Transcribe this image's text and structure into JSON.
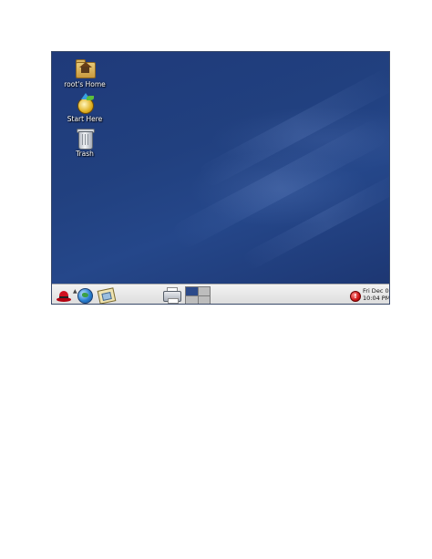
{
  "desktop": {
    "icons": [
      {
        "label": "root's Home",
        "icon": "home-folder-icon"
      },
      {
        "label": "Start Here",
        "icon": "start-here-icon"
      },
      {
        "label": "Trash",
        "icon": "trash-icon"
      }
    ],
    "wallpaper_color": "#21407f"
  },
  "panel": {
    "launchers": [
      {
        "icon": "red-hat-main-menu-icon"
      },
      {
        "icon": "web-browser-globe-icon"
      },
      {
        "icon": "email-client-icon"
      },
      {
        "icon": "printer-manager-icon"
      }
    ],
    "workspaces": [
      {
        "name": "workspace-1",
        "active": true
      },
      {
        "name": "workspace-2",
        "active": false
      },
      {
        "name": "workspace-3",
        "active": false
      },
      {
        "name": "workspace-4",
        "active": false
      }
    ],
    "update_alert": {
      "icon": "update-alert-icon",
      "glyph": "!"
    },
    "clock": {
      "date": "Fri Dec 07",
      "time": "10:04 PM"
    }
  }
}
